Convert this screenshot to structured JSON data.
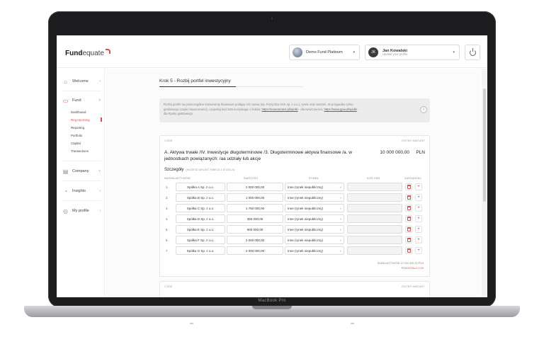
{
  "device": {
    "label": "MacBook Pro"
  },
  "header": {
    "logo_bold": "Fund",
    "logo_thin": "equate",
    "fund_name": "Demo Fund Platinum",
    "user_initials": "JK",
    "user_name": "Jan Kowalski",
    "user_sub": "Update your profile"
  },
  "sidebar": {
    "welcome": "Welcome",
    "fund": "Fund",
    "sub": [
      "Dashboard",
      "Reg reporting",
      "Reporting",
      "Portfolio",
      "Capital",
      "Transactions"
    ],
    "company": "Company",
    "insights": "Insights",
    "profile": "My profile"
  },
  "main": {
    "step_title": "Krok 5 - Rozbij portfel inwestycyjny",
    "info_1": "Rozbij portfel na poszczególne instrumenty finansowe podając ich nazwę (np. Pożyczka XXX sp. z o.o.), rynek oraz wartość. W przypadku rynku",
    "info_2a": "giełdowego (części NewConnect), uzupełnij kod ISIN korzystając z linków: ",
    "info_link1": "https://newconnect.pl/spolki",
    "info_2b": " - dla NewConnect, ",
    "info_link2": "https://www.gpw.pl/spolki",
    "info_2c": " -",
    "info_3": "dla Rynku giełdowego",
    "card": {
      "code_label": "CODE",
      "enter_amount": "ENTER AMOUNT",
      "title": "A. Aktywa trwałe /IV. Inwestycje długoterminowe /3. Długoterminowe aktywa finansowe /a. w jednostkach powiązanych: /aa udziały lub akcje",
      "amount": "10 000 000,00",
      "currency": "PLN",
      "section": "Szczegóły",
      "section_hint": "(MOŻESZ WKLEIĆ TABELĘ Z EXCELA)",
      "headers": [
        "NAZWA AKTYWÓW",
        "WARTOŚĆ",
        "RYNEK",
        "KOD ISIN",
        "ZARZĄDZAJ"
      ],
      "rows": [
        {
          "num": "1.",
          "name": "Spółka A Sp. z o.o.",
          "value": "2 000 000,00",
          "market": "Inne (rynek niepubliczny)"
        },
        {
          "num": "2.",
          "name": "Spółka B Sp. z o.o.",
          "value": "1 000 000,00",
          "market": "Inne (rynek niepubliczny)"
        },
        {
          "num": "3.",
          "name": "Spółka C Sp. z o.o.",
          "value": "1 750 000,00",
          "market": "Inne (rynek niepubliczny)"
        },
        {
          "num": "4.",
          "name": "Spółka D Sp. z o.o.",
          "value": "350 000,00",
          "market": "Inne (rynek niepubliczny)"
        },
        {
          "num": "5.",
          "name": "Spółka E Sp. z o.o.",
          "value": "900 000,00",
          "market": "Inne (rynek niepubliczny)"
        },
        {
          "num": "6.",
          "name": "Spółka F Sp. z o.o.",
          "value": "2 000 000,00",
          "market": "Inne (rynek niepubliczny)"
        },
        {
          "num": "7.",
          "name": "Spółka G Sp. z o.o.",
          "value": "2 000 000,00",
          "market": "Inne (rynek niepubliczny)"
        }
      ],
      "sum_label": "SUMA AKTYWÓW 10 000 000,00 PLN",
      "rest_label": "POZOSTAŁO 0,00"
    },
    "card2": {
      "code_label": "CODE",
      "enter_amount": "ENTER AMOUNT"
    }
  },
  "colors": {
    "accent": "#e54d4d",
    "frame": "#1d1d1f"
  }
}
